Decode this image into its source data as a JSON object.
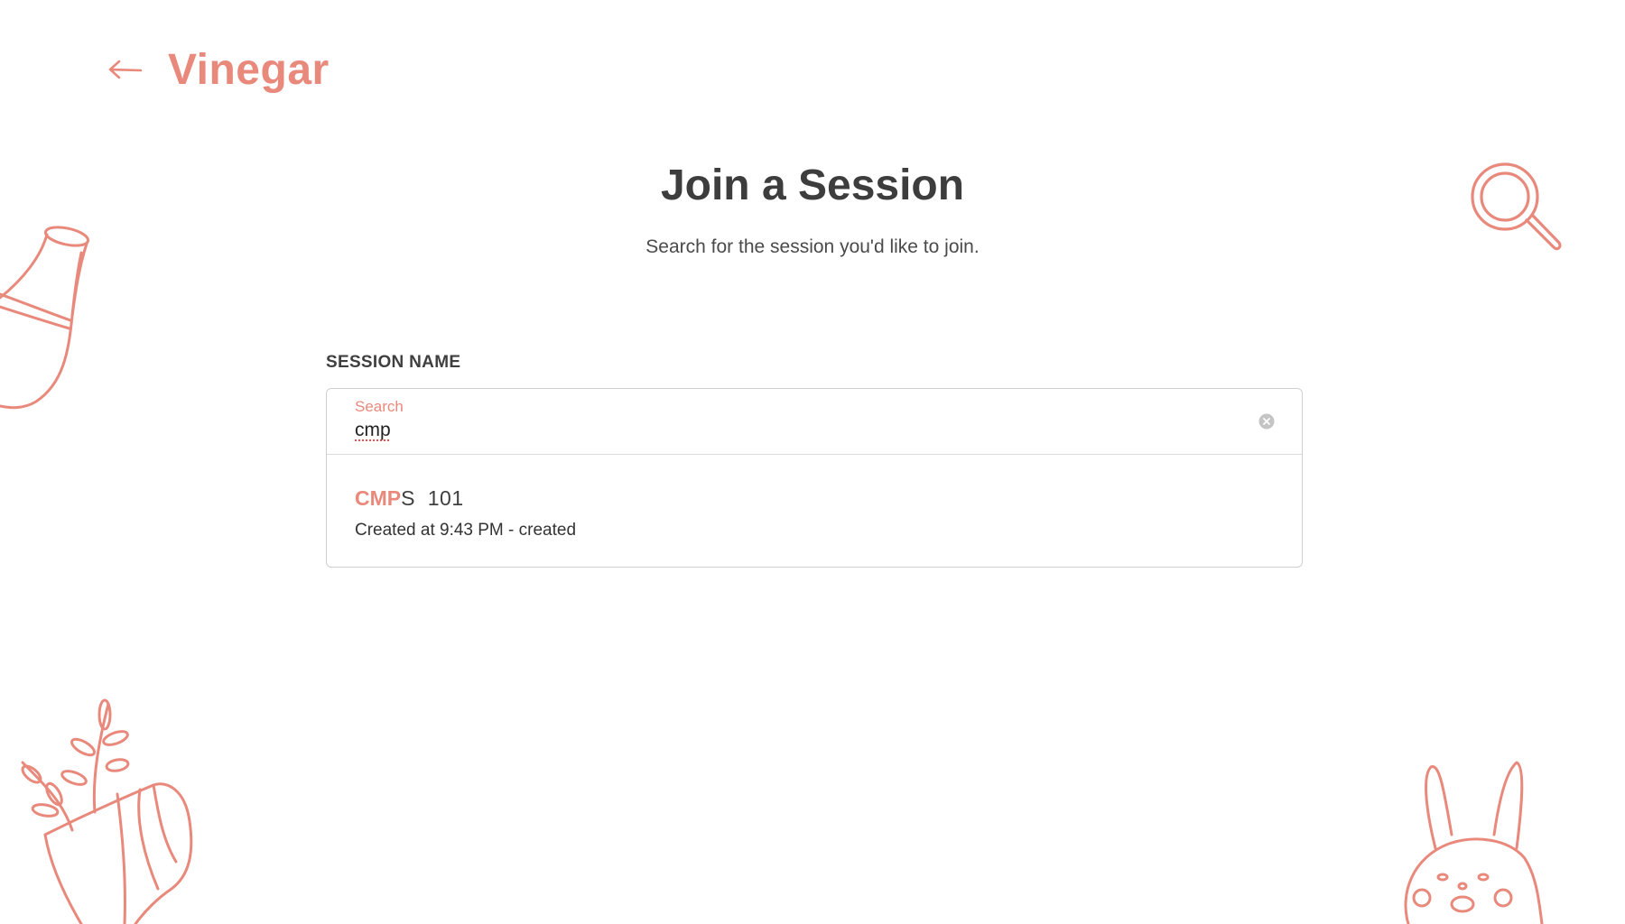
{
  "header": {
    "back_icon": "arrow-left-icon",
    "brand": "Vinegar"
  },
  "main": {
    "title": "Join a Session",
    "subtitle": "Search for the session you'd like to join."
  },
  "form": {
    "field_label": "SESSION NAME",
    "search": {
      "floating_label": "Search",
      "value": "cmp",
      "clear_icon": "clear-circle-icon"
    },
    "results": [
      {
        "title_match": "CMP",
        "title_rest": "S  101",
        "meta": "Created at 9:43 PM - created"
      }
    ]
  },
  "decorations": {
    "icons": [
      "bottle-doodle-icon",
      "magnifier-doodle-icon",
      "plant-pot-doodle-icon",
      "bunny-doodle-icon"
    ]
  },
  "colors": {
    "accent": "#e8897c",
    "text": "#3f3f3f",
    "border": "#cfcfcf"
  }
}
